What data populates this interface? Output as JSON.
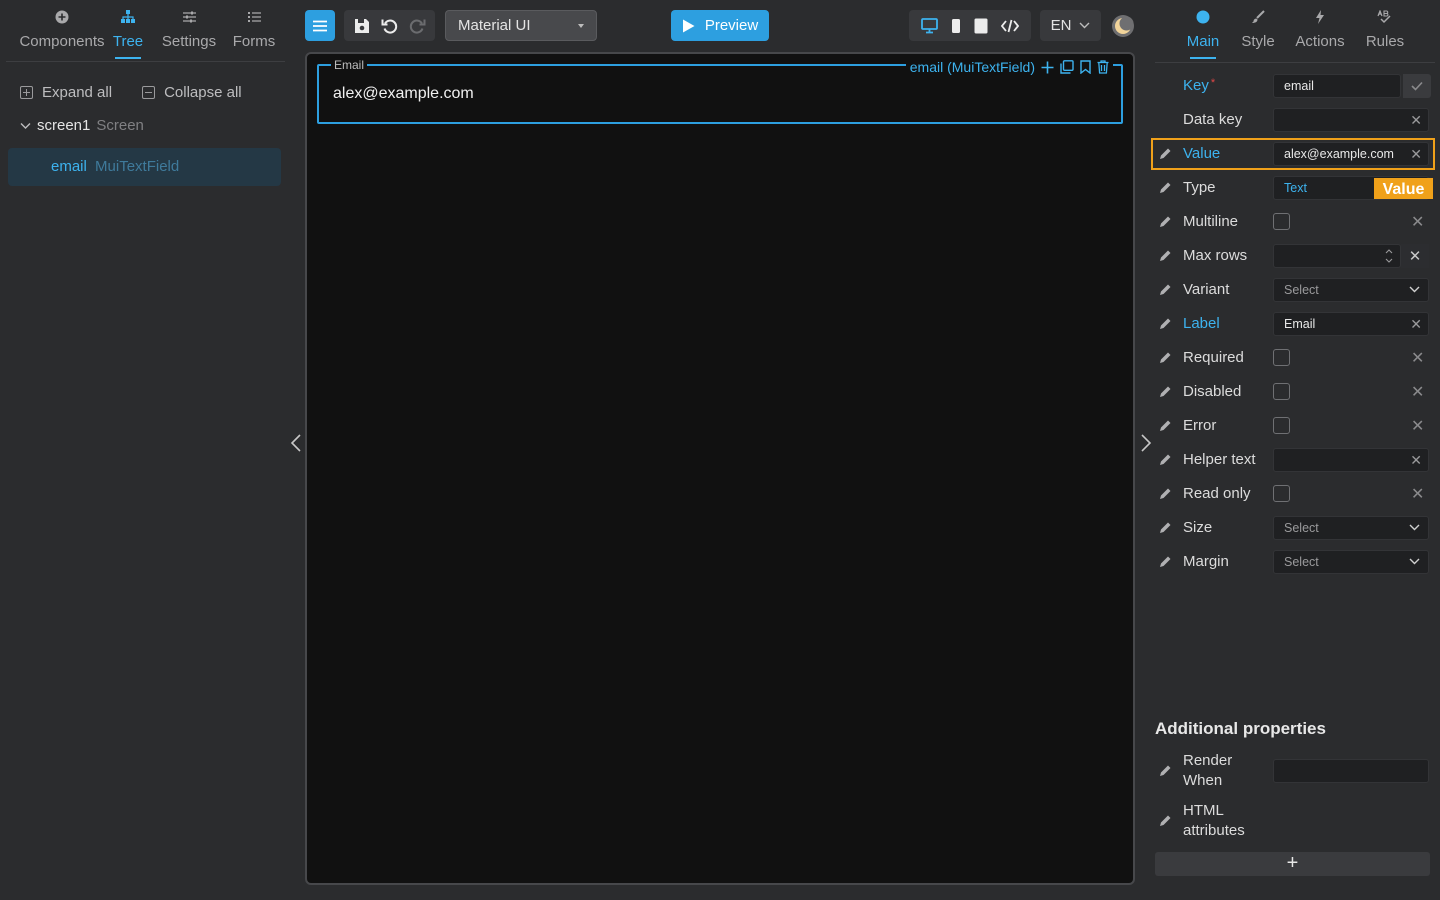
{
  "left": {
    "tabs": [
      {
        "label": "Components",
        "icon": "plus-circle-icon",
        "active": false
      },
      {
        "label": "Tree",
        "icon": "hierarchy-icon",
        "active": true
      },
      {
        "label": "Settings",
        "icon": "sliders-icon",
        "active": false
      },
      {
        "label": "Forms",
        "icon": "list-icon",
        "active": false
      }
    ],
    "expand_all": "Expand all",
    "collapse_all": "Collapse all",
    "tree": {
      "root": {
        "name": "screen1",
        "type": "Screen"
      },
      "node": {
        "name": "email",
        "type": "MuiTextField"
      }
    }
  },
  "toolbar": {
    "ui_library": "Material UI",
    "preview_label": "Preview",
    "language": "EN"
  },
  "canvas": {
    "field_label": "Email",
    "field_value": "alex@example.com",
    "selection_tag": "email (MuiTextField)"
  },
  "right": {
    "tabs": [
      {
        "label": "Main",
        "icon": "circle-icon",
        "active": true
      },
      {
        "label": "Style",
        "icon": "brush-icon",
        "active": false
      },
      {
        "label": "Actions",
        "icon": "lightning-icon",
        "active": false
      },
      {
        "label": "Rules",
        "icon": "rules-icon",
        "active": false
      }
    ],
    "props": {
      "key": {
        "label": "Key",
        "value": "email"
      },
      "data_key": {
        "label": "Data key",
        "value": ""
      },
      "value": {
        "label": "Value",
        "value": "alex@example.com"
      },
      "type": {
        "label": "Type",
        "value": "Text"
      },
      "multiline": {
        "label": "Multiline"
      },
      "max_rows": {
        "label": "Max rows",
        "value": ""
      },
      "variant": {
        "label": "Variant",
        "value": "Select"
      },
      "label": {
        "label": "Label",
        "value": "Email"
      },
      "required": {
        "label": "Required"
      },
      "disabled": {
        "label": "Disabled"
      },
      "error": {
        "label": "Error"
      },
      "helper_text": {
        "label": "Helper text",
        "value": ""
      },
      "read_only": {
        "label": "Read only"
      },
      "size": {
        "label": "Size",
        "value": "Select"
      },
      "margin": {
        "label": "Margin",
        "value": "Select"
      }
    },
    "highlight_tag": "Value",
    "additional": {
      "title": "Additional properties",
      "render_when": "Render When",
      "html_attributes": "HTML attributes",
      "add_symbol": "+"
    }
  },
  "colors": {
    "accent": "#3db3ef",
    "highlight": "#f0a11a",
    "background": "#2b2c2e",
    "canvas": "#111111"
  }
}
